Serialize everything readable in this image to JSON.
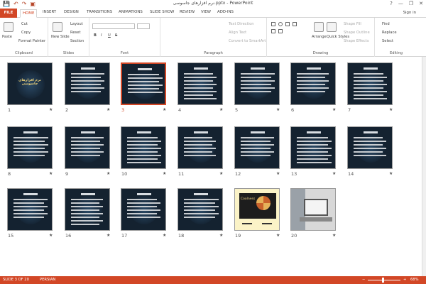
{
  "titlebar": {
    "title": "نرم افزارهای جاسوسی.pptx - PowerPoint",
    "help": "?",
    "minimize": "—",
    "restore": "❐",
    "close": "✕"
  },
  "qat": {
    "save": "💾",
    "undo": "↶",
    "redo": "↷",
    "start": "▣"
  },
  "tabs": {
    "file": "FILE",
    "home": "HOME",
    "insert": "INSERT",
    "design": "DESIGN",
    "transitions": "TRANSITIONS",
    "animations": "ANIMATIONS",
    "slideshow": "SLIDE SHOW",
    "review": "REVIEW",
    "view": "VIEW",
    "addins": "ADD-INS",
    "signin": "Sign in"
  },
  "ribbon": {
    "clipboard": {
      "label": "Clipboard",
      "paste": "Paste",
      "cut": "Cut",
      "copy": "Copy",
      "format_painter": "Format Painter"
    },
    "slides": {
      "label": "Slides",
      "new_slide": "New Slide",
      "layout": "Layout",
      "reset": "Reset",
      "section": "Section"
    },
    "font": {
      "label": "Font",
      "bold": "B",
      "italic": "I",
      "underline": "U",
      "strike": "S"
    },
    "paragraph": {
      "label": "Paragraph",
      "text_direction": "Text Direction",
      "align_text": "Align Text",
      "convert_smartart": "Convert to SmartArt"
    },
    "drawing": {
      "label": "Drawing",
      "arrange": "Arrange",
      "quick_styles": "Quick Styles",
      "shape_fill": "Shape Fill",
      "shape_outline": "Shape Outline",
      "shape_effects": "Shape Effects"
    },
    "editing": {
      "label": "Editing",
      "find": "Find",
      "replace": "Replace",
      "select": "Select"
    }
  },
  "slides": [
    {
      "n": "1",
      "star": "★",
      "title": "نرم افزارهای جاسوسی"
    },
    {
      "n": "2",
      "star": "★"
    },
    {
      "n": "3",
      "star": "★"
    },
    {
      "n": "4",
      "star": "★"
    },
    {
      "n": "5",
      "star": "★"
    },
    {
      "n": "6",
      "star": "★"
    },
    {
      "n": "7",
      "star": "★"
    },
    {
      "n": "8",
      "star": "★"
    },
    {
      "n": "9",
      "star": "★"
    },
    {
      "n": "10",
      "star": "★"
    },
    {
      "n": "11",
      "star": "★"
    },
    {
      "n": "12",
      "star": "★"
    },
    {
      "n": "13",
      "star": "★"
    },
    {
      "n": "14",
      "star": "★"
    },
    {
      "n": "15",
      "star": "★"
    },
    {
      "n": "16",
      "star": "★"
    },
    {
      "n": "17",
      "star": "★"
    },
    {
      "n": "18",
      "star": "★"
    },
    {
      "n": "19",
      "star": "★",
      "title": "Coolness"
    },
    {
      "n": "20",
      "star": "★"
    }
  ],
  "status": {
    "slide": "SLIDE 3 OF 20",
    "language": "PERSIAN",
    "zoom": "68%",
    "zoom_minus": "−",
    "zoom_plus": "+"
  },
  "colors": {
    "accent": "#d24726",
    "slide_bg": "#142230"
  }
}
